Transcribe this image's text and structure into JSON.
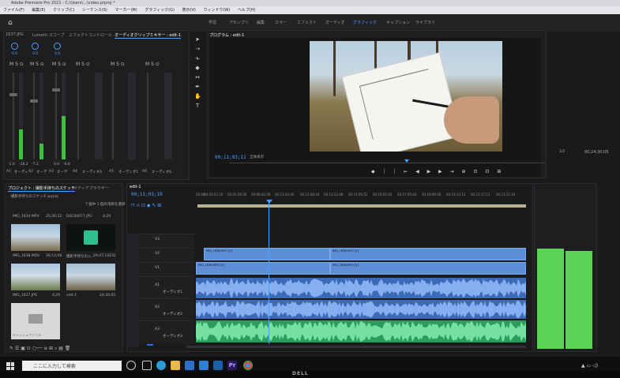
{
  "window": {
    "title": "Adobe Premiere Pro 2021 - C:\\Users\\...\\video.prproj *",
    "menu": [
      "ファイル(F)",
      "編集(E)",
      "クリップ(C)",
      "シーケンス(S)",
      "マーカー(M)",
      "グラフィック(G)",
      "表示(V)",
      "ウィンドウ(W)",
      "ヘルプ(H)"
    ]
  },
  "workspace_tabs": [
    "学習",
    "アセンブリ",
    "編集",
    "カラー",
    "エフェクト",
    "オーディオ",
    "グラフィック",
    "キャプション",
    "ライブラリ"
  ],
  "workspace_active": "グラフィック",
  "source_panel": {
    "tabs": [
      "1637.JPG",
      "Lumetri スコープ",
      "エフェクトコントロール",
      "オーディオクリップミキサー : edit-1"
    ],
    "channels": [
      {
        "knob": "0.0",
        "label": "A1",
        "name": "オーディ",
        "meter": 0.35
      },
      {
        "knob": "0.0",
        "label": "A2",
        "name": "オーデ",
        "meter": 0.18
      },
      {
        "knob": "0.0",
        "label": "A3",
        "name": "オーデ",
        "meter": 0.5
      },
      {
        "knob": "",
        "label": "A4",
        "name": "オーディオ4",
        "meter": 0.0
      },
      {
        "knob": "",
        "label": "A5",
        "name": "オーディオ5",
        "meter": 0.0
      },
      {
        "knob": "",
        "label": "A6",
        "name": "オーディオ6",
        "meter": 0.0
      }
    ],
    "fader_values": [
      "-1.0",
      "-18.2",
      "-7.2",
      "0.0",
      "-0.8"
    ]
  },
  "program_monitor": {
    "tab": "プログラム : edit-1",
    "timecode": "00;11;03;11",
    "fit": "全体表示",
    "fraction": "1/2",
    "duration": "00;24;30;05"
  },
  "project_panel": {
    "tabs": [
      "プロジェクト : 撮影手持ちのスケッチ",
      "メディアブラウザー"
    ],
    "filename": "撮影手持ちのスケッチ.prproj",
    "count": "7 個中 1 個の項目を選択",
    "items": [
      {
        "name": "IMG_1634.MP4",
        "dur": "25;36;12"
      },
      {
        "name": "DSC00077.JPG",
        "dur": "4;29"
      },
      {
        "name": "IMG_1638.MOV",
        "dur": "26;14;08"
      },
      {
        "name": "撮影手持ちの入...",
        "dur": "29;47;14232"
      },
      {
        "name": "IMG_1637.JPG",
        "dur": "4;29"
      },
      {
        "name": "edit-1",
        "dur": "24;30;05"
      },
      {
        "name": "キャッシュファイル",
        "dur": ""
      }
    ]
  },
  "timeline": {
    "tab": "edit-1",
    "timecode": "00;11;03;10",
    "ruler": [
      "00;00",
      "00;02;02;10",
      "00;05;06;26",
      "00;08;40;36",
      "00;11;44;40",
      "00;12;48;44",
      "00;13;52;48",
      "00;14;56;52",
      "00;16;01;00",
      "00;17;05;04",
      "00;18;09;08",
      "00;19;13;12",
      "00;21;17;12",
      "00;21;21;16"
    ],
    "tracks": {
      "video": [
        "V3",
        "V2",
        "V1"
      ],
      "audio": [
        "A1",
        "A2",
        "A3"
      ]
    },
    "clips": {
      "v1a": "IMG_1638.MOV [V]",
      "v1b": "IMG_1638.MOV [V]",
      "v2a": "IMG_1638.MOV [V]",
      "v2b": "IMG_1638.MOV [V]"
    },
    "audio_track_names": [
      "オーディオ1",
      "オーディオ2",
      "オーディオ3"
    ],
    "colors": {
      "video": "#5d8fd6",
      "audio_blue": "#3c69b8",
      "audio_green": "#33a866"
    }
  },
  "right_meter": {
    "labels": [
      "S",
      "S"
    ],
    "levels": [
      0.74,
      0.72
    ]
  },
  "taskbar": {
    "search_placeholder": "ここに入力して検索",
    "apps": [
      "task-view-icon",
      "edge-icon",
      "explorer-icon",
      "store-icon",
      "mail-icon",
      "premiere-icon",
      "chrome-icon"
    ],
    "premiere_label": "Pr"
  },
  "bezel_brand": "DELL"
}
